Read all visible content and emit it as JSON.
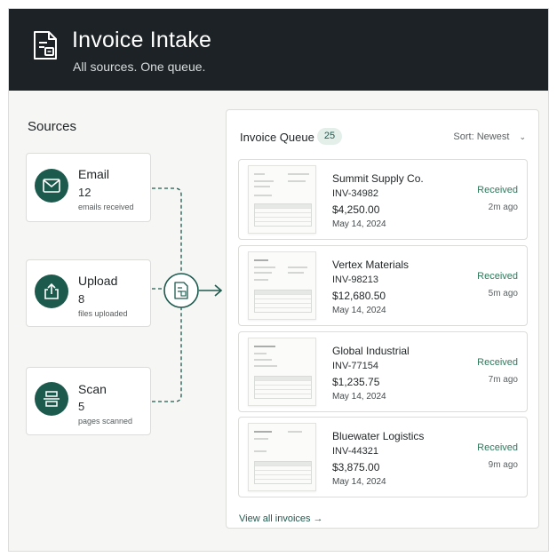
{
  "header": {
    "title": "Invoice Intake",
    "subtitle": "All sources. One queue."
  },
  "sources": {
    "heading": "Sources",
    "items": [
      {
        "name": "Email",
        "count": "12",
        "desc": "emails received",
        "icon": "envelope-icon"
      },
      {
        "name": "Upload",
        "count": "8",
        "desc": "files uploaded",
        "icon": "upload-icon"
      },
      {
        "name": "Scan",
        "count": "5",
        "desc": "pages scanned",
        "icon": "scanner-icon"
      }
    ]
  },
  "queue": {
    "title": "Invoice Queue",
    "count": "25",
    "sort_label": "Sort:",
    "sort_value": "Newest",
    "view_all": "View all invoices →",
    "invoices": [
      {
        "vendor": "Summit Supply Co.",
        "number": "INV-34982",
        "amount": "$4,250.00",
        "date": "May 14, 2024",
        "status": "Received",
        "age": "2m ago"
      },
      {
        "vendor": "Vertex Materials",
        "number": "INV-98213",
        "amount": "$12,680.50",
        "date": "May 14, 2024",
        "status": "Received",
        "age": "5m ago"
      },
      {
        "vendor": "Global Industrial",
        "number": "INV-77154",
        "amount": "$1,235.75",
        "date": "May 14, 2024",
        "status": "Received",
        "age": "7m ago"
      },
      {
        "vendor": "Bluewater Logistics",
        "number": "INV-44321",
        "amount": "$3,875.00",
        "date": "May 14, 2024",
        "status": "Received",
        "age": "9m ago"
      }
    ]
  },
  "colors": {
    "header_bg": "#1c2225",
    "accent": "#1d5a4e",
    "status_green": "#2e7a5c"
  }
}
